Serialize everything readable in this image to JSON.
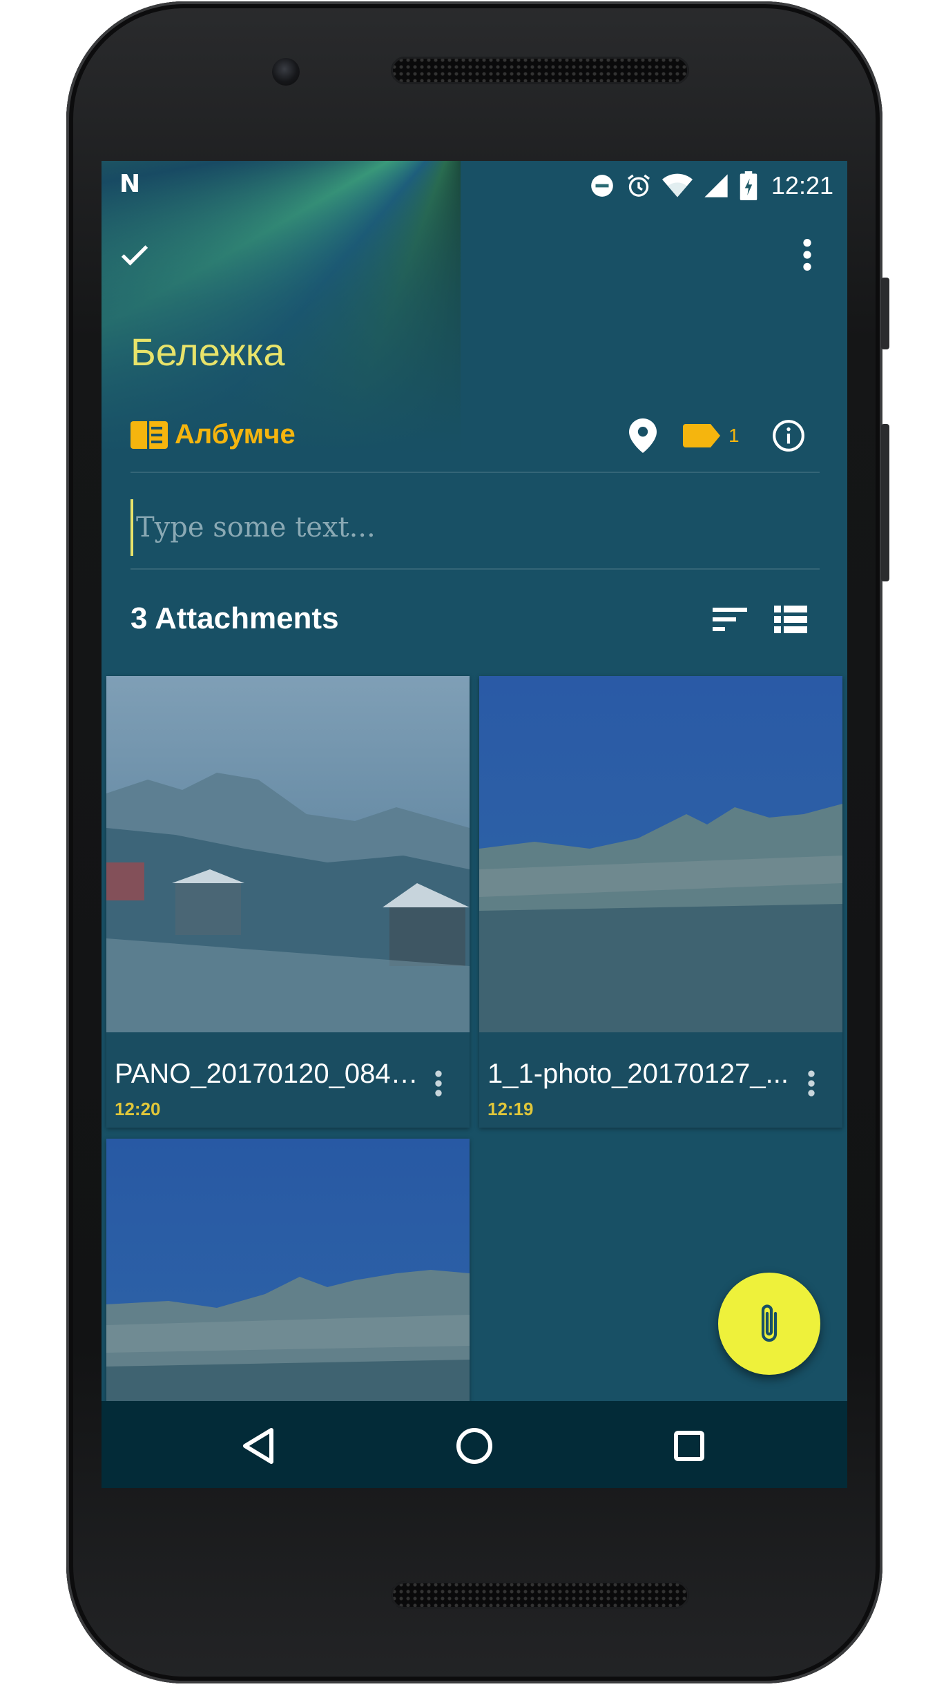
{
  "status_bar": {
    "time": "12:21",
    "icons": [
      "n-logo",
      "do-not-disturb-icon",
      "alarm-icon",
      "wifi-icon",
      "cell-signal-icon",
      "battery-icon"
    ]
  },
  "toolbar": {
    "done_icon": "check-icon",
    "overflow_icon": "more-vert-icon"
  },
  "note": {
    "title": "Бележка",
    "album_label": "Албумче",
    "tag_count": "1",
    "text_placeholder": "Type some text..."
  },
  "attachments": {
    "title": "3 Attachments",
    "sort_icon": "sort-icon",
    "view_icon": "view-list-icon",
    "items": [
      {
        "name": "PANO_20170120_0845...",
        "time": "12:20"
      },
      {
        "name": "1_1-photo_20170127_...",
        "time": "12:19"
      },
      {
        "name": "",
        "time": ""
      }
    ]
  },
  "fab": {
    "icon": "attach-file-icon"
  },
  "colors": {
    "background": "#185065",
    "title": "#e8e36a",
    "accent": "#f5b50e",
    "fab": "#eef13b",
    "navbar": "#032b38"
  }
}
